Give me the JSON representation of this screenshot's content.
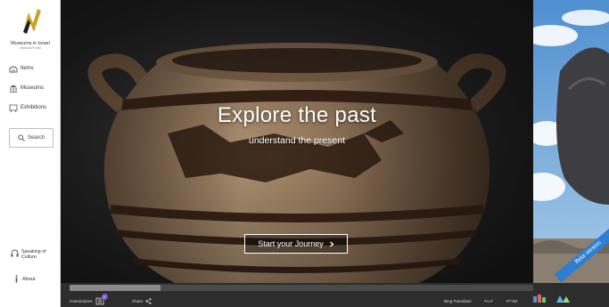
{
  "sidebar": {
    "brand_name": "Museums in Israel",
    "brand_sub": "National Portal",
    "nav": {
      "items_label": "Items",
      "museums_label": "Museums",
      "exhibitions_label": "Exhibitions"
    },
    "search_label": "Search",
    "speaking_label": "Speaking of Culture",
    "about_label": "About"
  },
  "hero": {
    "title": "Explore the past",
    "subtitle": "understand the present",
    "cta_label": "Start your Journey",
    "cta_icon": "chevron-right-icon"
  },
  "bottombar": {
    "connections_label": "Connections",
    "connections_count": "0",
    "share_label": "Share",
    "bing_label": "Bing Translator",
    "arabic_label": "عربية",
    "hebrew_label": "עברית"
  },
  "beta_label": "Beta version",
  "colors": {
    "accent": "#2f7fd0",
    "logo": "#c9a227",
    "bar": "#2d2d2d"
  },
  "scroll": {
    "position_fraction": 0.0,
    "visible_fraction": 0.2
  }
}
